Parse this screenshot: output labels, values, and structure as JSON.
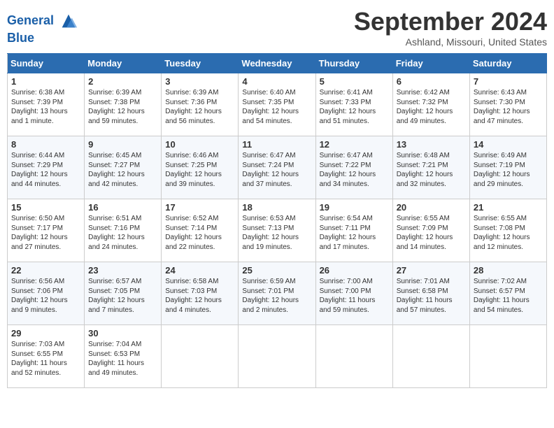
{
  "header": {
    "logo_line1": "General",
    "logo_line2": "Blue",
    "month": "September 2024",
    "location": "Ashland, Missouri, United States"
  },
  "weekdays": [
    "Sunday",
    "Monday",
    "Tuesday",
    "Wednesday",
    "Thursday",
    "Friday",
    "Saturday"
  ],
  "weeks": [
    [
      {
        "day": "1",
        "sunrise": "6:38 AM",
        "sunset": "7:39 PM",
        "daylight": "13 hours and 1 minute."
      },
      {
        "day": "2",
        "sunrise": "6:39 AM",
        "sunset": "7:38 PM",
        "daylight": "12 hours and 59 minutes."
      },
      {
        "day": "3",
        "sunrise": "6:39 AM",
        "sunset": "7:36 PM",
        "daylight": "12 hours and 56 minutes."
      },
      {
        "day": "4",
        "sunrise": "6:40 AM",
        "sunset": "7:35 PM",
        "daylight": "12 hours and 54 minutes."
      },
      {
        "day": "5",
        "sunrise": "6:41 AM",
        "sunset": "7:33 PM",
        "daylight": "12 hours and 51 minutes."
      },
      {
        "day": "6",
        "sunrise": "6:42 AM",
        "sunset": "7:32 PM",
        "daylight": "12 hours and 49 minutes."
      },
      {
        "day": "7",
        "sunrise": "6:43 AM",
        "sunset": "7:30 PM",
        "daylight": "12 hours and 47 minutes."
      }
    ],
    [
      {
        "day": "8",
        "sunrise": "6:44 AM",
        "sunset": "7:29 PM",
        "daylight": "12 hours and 44 minutes."
      },
      {
        "day": "9",
        "sunrise": "6:45 AM",
        "sunset": "7:27 PM",
        "daylight": "12 hours and 42 minutes."
      },
      {
        "day": "10",
        "sunrise": "6:46 AM",
        "sunset": "7:25 PM",
        "daylight": "12 hours and 39 minutes."
      },
      {
        "day": "11",
        "sunrise": "6:47 AM",
        "sunset": "7:24 PM",
        "daylight": "12 hours and 37 minutes."
      },
      {
        "day": "12",
        "sunrise": "6:47 AM",
        "sunset": "7:22 PM",
        "daylight": "12 hours and 34 minutes."
      },
      {
        "day": "13",
        "sunrise": "6:48 AM",
        "sunset": "7:21 PM",
        "daylight": "12 hours and 32 minutes."
      },
      {
        "day": "14",
        "sunrise": "6:49 AM",
        "sunset": "7:19 PM",
        "daylight": "12 hours and 29 minutes."
      }
    ],
    [
      {
        "day": "15",
        "sunrise": "6:50 AM",
        "sunset": "7:17 PM",
        "daylight": "12 hours and 27 minutes."
      },
      {
        "day": "16",
        "sunrise": "6:51 AM",
        "sunset": "7:16 PM",
        "daylight": "12 hours and 24 minutes."
      },
      {
        "day": "17",
        "sunrise": "6:52 AM",
        "sunset": "7:14 PM",
        "daylight": "12 hours and 22 minutes."
      },
      {
        "day": "18",
        "sunrise": "6:53 AM",
        "sunset": "7:13 PM",
        "daylight": "12 hours and 19 minutes."
      },
      {
        "day": "19",
        "sunrise": "6:54 AM",
        "sunset": "7:11 PM",
        "daylight": "12 hours and 17 minutes."
      },
      {
        "day": "20",
        "sunrise": "6:55 AM",
        "sunset": "7:09 PM",
        "daylight": "12 hours and 14 minutes."
      },
      {
        "day": "21",
        "sunrise": "6:55 AM",
        "sunset": "7:08 PM",
        "daylight": "12 hours and 12 minutes."
      }
    ],
    [
      {
        "day": "22",
        "sunrise": "6:56 AM",
        "sunset": "7:06 PM",
        "daylight": "12 hours and 9 minutes."
      },
      {
        "day": "23",
        "sunrise": "6:57 AM",
        "sunset": "7:05 PM",
        "daylight": "12 hours and 7 minutes."
      },
      {
        "day": "24",
        "sunrise": "6:58 AM",
        "sunset": "7:03 PM",
        "daylight": "12 hours and 4 minutes."
      },
      {
        "day": "25",
        "sunrise": "6:59 AM",
        "sunset": "7:01 PM",
        "daylight": "12 hours and 2 minutes."
      },
      {
        "day": "26",
        "sunrise": "7:00 AM",
        "sunset": "7:00 PM",
        "daylight": "11 hours and 59 minutes."
      },
      {
        "day": "27",
        "sunrise": "7:01 AM",
        "sunset": "6:58 PM",
        "daylight": "11 hours and 57 minutes."
      },
      {
        "day": "28",
        "sunrise": "7:02 AM",
        "sunset": "6:57 PM",
        "daylight": "11 hours and 54 minutes."
      }
    ],
    [
      {
        "day": "29",
        "sunrise": "7:03 AM",
        "sunset": "6:55 PM",
        "daylight": "11 hours and 52 minutes."
      },
      {
        "day": "30",
        "sunrise": "7:04 AM",
        "sunset": "6:53 PM",
        "daylight": "11 hours and 49 minutes."
      },
      null,
      null,
      null,
      null,
      null
    ]
  ]
}
